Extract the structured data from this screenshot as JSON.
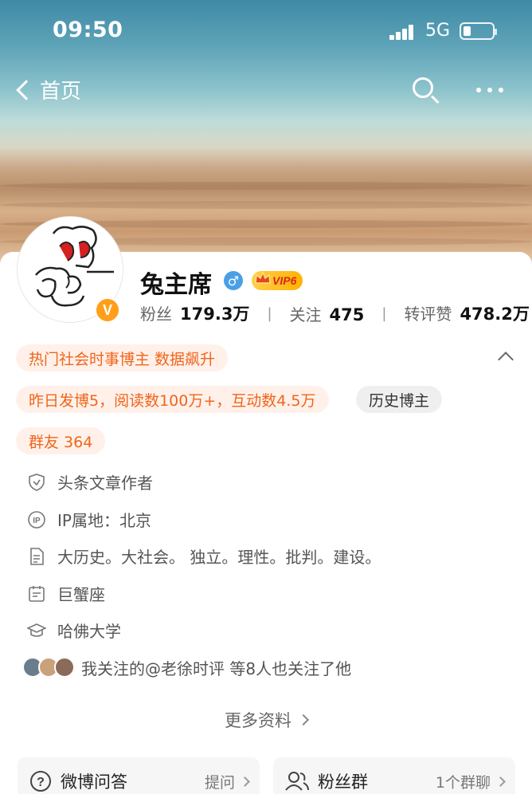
{
  "status_bar": {
    "time": "09:50",
    "network": "5G"
  },
  "nav": {
    "back_label": "首页"
  },
  "profile": {
    "name": "兔主席",
    "vip_label": "VIP6",
    "verified_mark": "V",
    "gender_symbol": "♂",
    "stats": [
      {
        "label": "粉丝",
        "value": "179.3万"
      },
      {
        "label": "关注",
        "value": "475"
      },
      {
        "label": "转评赞",
        "value": "478.2万"
      }
    ]
  },
  "tags": {
    "hot": "热门社会时事博主 数据飙升",
    "daily": "昨日发博5，阅读数100万+，互动数4.5万",
    "history": "历史博主",
    "group": "群友 364"
  },
  "info": {
    "author": "头条文章作者",
    "ip": "IP属地：北京",
    "bio": "大历史。大社会。 独立。理性。批判。建设。",
    "zodiac": "巨蟹座",
    "school": "哈佛大学"
  },
  "mutual_follow": "我关注的@老徐时评  等8人也关注了他",
  "more_info": "更多资料",
  "bottom_cards": {
    "qa": {
      "title": "微博问答",
      "action": "提问"
    },
    "fans": {
      "title": "粉丝群",
      "action": "1个群聊"
    }
  },
  "colors": {
    "accent_orange": "#f0651b",
    "badge_orange": "#ff9f1a",
    "male_blue": "#4a9fe6"
  }
}
